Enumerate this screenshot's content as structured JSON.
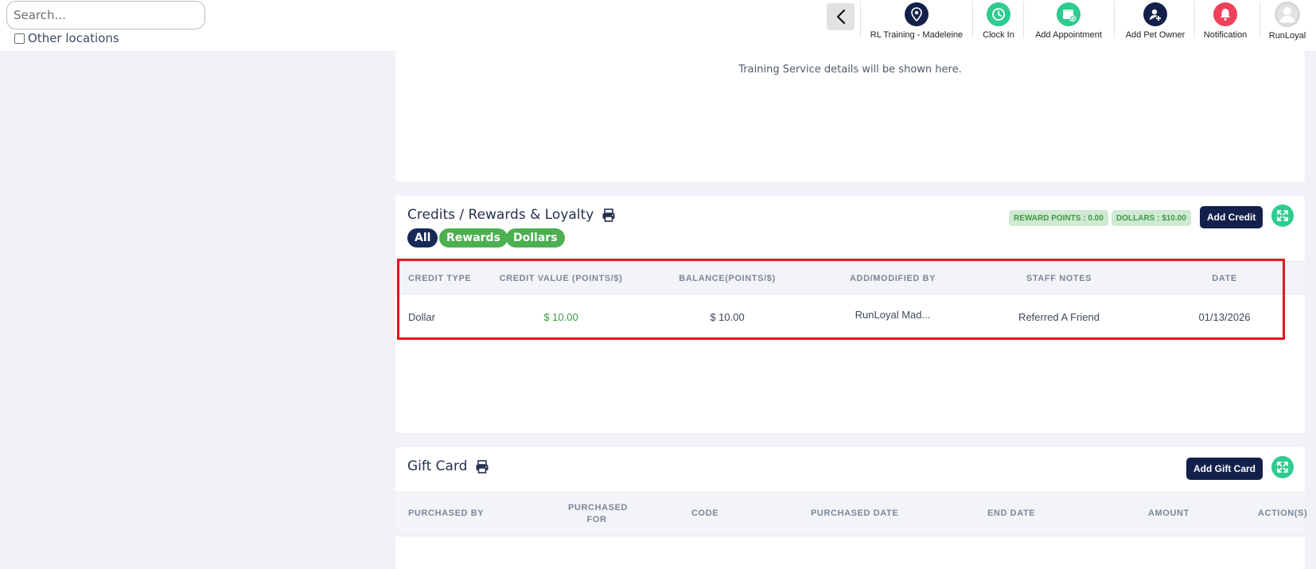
{
  "header": {
    "search_placeholder": "Search...",
    "other_locations_label": "Other locations",
    "nav": [
      {
        "label": "RL Training - Madeleine",
        "icon": "location-pin-icon",
        "color": "#13204b"
      },
      {
        "label": "Clock In",
        "icon": "clock-icon",
        "color": "#2ecc8e"
      },
      {
        "label": "Add Appointment",
        "icon": "calendar-add-icon",
        "color": "#2ecc8e"
      },
      {
        "label": "Add Pet Owner",
        "icon": "add-user-icon",
        "color": "#13204b"
      },
      {
        "label": "Notification",
        "icon": "bell-icon",
        "color": "#f0405a"
      },
      {
        "label": "RunLoyal",
        "icon": "avatar-icon",
        "color": "#d9d9d9"
      }
    ]
  },
  "training": {
    "message": "Training Service details will be shown here."
  },
  "credits": {
    "title": "Credits / Rewards & Loyalty",
    "filters": [
      "All",
      "Rewards",
      "Dollars"
    ],
    "reward_points_badge": "REWARD POINTS : 0.00",
    "dollars_badge": "DOLLARS : $10.00",
    "add_button": "Add Credit",
    "columns": [
      "CREDIT TYPE",
      "CREDIT VALUE (POINTS/$)",
      "BALANCE(POINTS/$)",
      "ADD/MODIFIED BY",
      "STAFF NOTES",
      "DATE"
    ],
    "rows": [
      {
        "credit_type": "Dollar",
        "credit_value": "$ 10.00",
        "balance": "$ 10.00",
        "modified_by": "RunLoyal Mad...",
        "staff_notes": "Referred A Friend",
        "date": "01/13/2026"
      }
    ]
  },
  "gift_card": {
    "title": "Gift Card",
    "add_button": "Add Gift Card",
    "columns": [
      "PURCHASED BY",
      "PURCHASED FOR",
      "CODE",
      "PURCHASED DATE",
      "END DATE",
      "AMOUNT",
      "ACTION(S)"
    ]
  },
  "colors": {
    "navy": "#13204b",
    "green": "#4caf50",
    "teal": "#2ecc8e",
    "highlight": "#e3181e"
  }
}
